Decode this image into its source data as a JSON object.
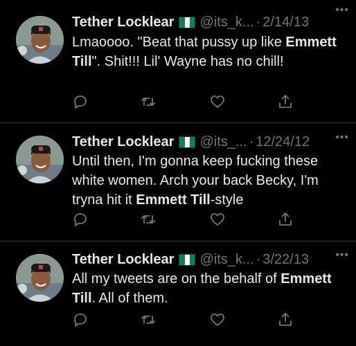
{
  "tweets": [
    {
      "author": "Tether Locklear",
      "handle": "@its_k...",
      "separator": "·",
      "date": "2/14/13",
      "text_parts": [
        "Lmaoooo. \"Beat that pussy up like ",
        "Emmett Till",
        "\". Shit!!! Lil' Wayne has no chill!"
      ]
    },
    {
      "author": "Tether Locklear",
      "handle": "@its_...",
      "separator": "·",
      "date": "12/24/12",
      "text_parts": [
        "Until then, I'm gonna keep fucking these white women. Arch your back Becky, I'm tryna hit it ",
        "Emmett Till",
        "-style"
      ]
    },
    {
      "author": "Tether Locklear",
      "handle": "@its_k...",
      "separator": "·",
      "date": "3/22/13",
      "text_parts": [
        "All my tweets are on the behalf of ",
        "Emmett Till",
        ". All of them."
      ]
    }
  ],
  "icons": {
    "more": "more-horizontal-icon",
    "reply": "reply-icon",
    "retweet": "retweet-icon",
    "like": "heart-icon",
    "share": "share-icon"
  },
  "colors": {
    "background": "#000000",
    "text": "#e7e9ea",
    "muted": "#71767b",
    "divider": "#2f3336",
    "flag_green": "#008751",
    "flag_white": "#ffffff"
  }
}
